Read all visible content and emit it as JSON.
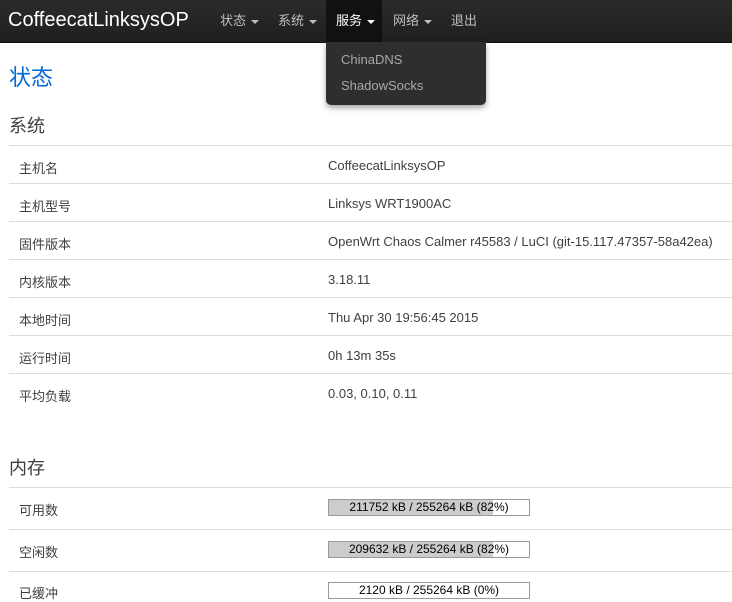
{
  "brand": "CoffeecatLinksysOP",
  "nav": [
    {
      "label": "状态",
      "has_caret": true
    },
    {
      "label": "系统",
      "has_caret": true
    },
    {
      "label": "服务",
      "has_caret": true,
      "active": true
    },
    {
      "label": "网络",
      "has_caret": true
    },
    {
      "label": "退出",
      "has_caret": false
    }
  ],
  "services_menu": {
    "items": [
      {
        "label": "ChinaDNS"
      },
      {
        "label": "ShadowSocks"
      }
    ]
  },
  "page": {
    "title": "状态"
  },
  "system": {
    "title": "系统",
    "rows": [
      {
        "label": "主机名",
        "value": "CoffeecatLinksysOP"
      },
      {
        "label": "主机型号",
        "value": "Linksys WRT1900AC"
      },
      {
        "label": "固件版本",
        "value": "OpenWrt Chaos Calmer r45583 / LuCI (git-15.117.47357-58a42ea)"
      },
      {
        "label": "内核版本",
        "value": "3.18.11"
      },
      {
        "label": "本地时间",
        "value": "Thu Apr 30 19:56:45 2015"
      },
      {
        "label": "运行时间",
        "value": "0h 13m 35s"
      },
      {
        "label": "平均负载",
        "value": "0.03, 0.10, 0.11"
      }
    ]
  },
  "memory": {
    "title": "内存",
    "rows": [
      {
        "label": "可用数",
        "bar_text": "211752 kB / 255264 kB (82%)",
        "percent": 82
      },
      {
        "label": "空闲数",
        "bar_text": "209632 kB / 255264 kB (82%)",
        "percent": 82
      },
      {
        "label": "已缓冲",
        "bar_text": "2120 kB / 255264 kB (0%)",
        "percent": 0
      }
    ]
  },
  "colors": {
    "topbar": "#222222",
    "title_blue": "#0069d6",
    "bar_fill": "#cccccc"
  }
}
